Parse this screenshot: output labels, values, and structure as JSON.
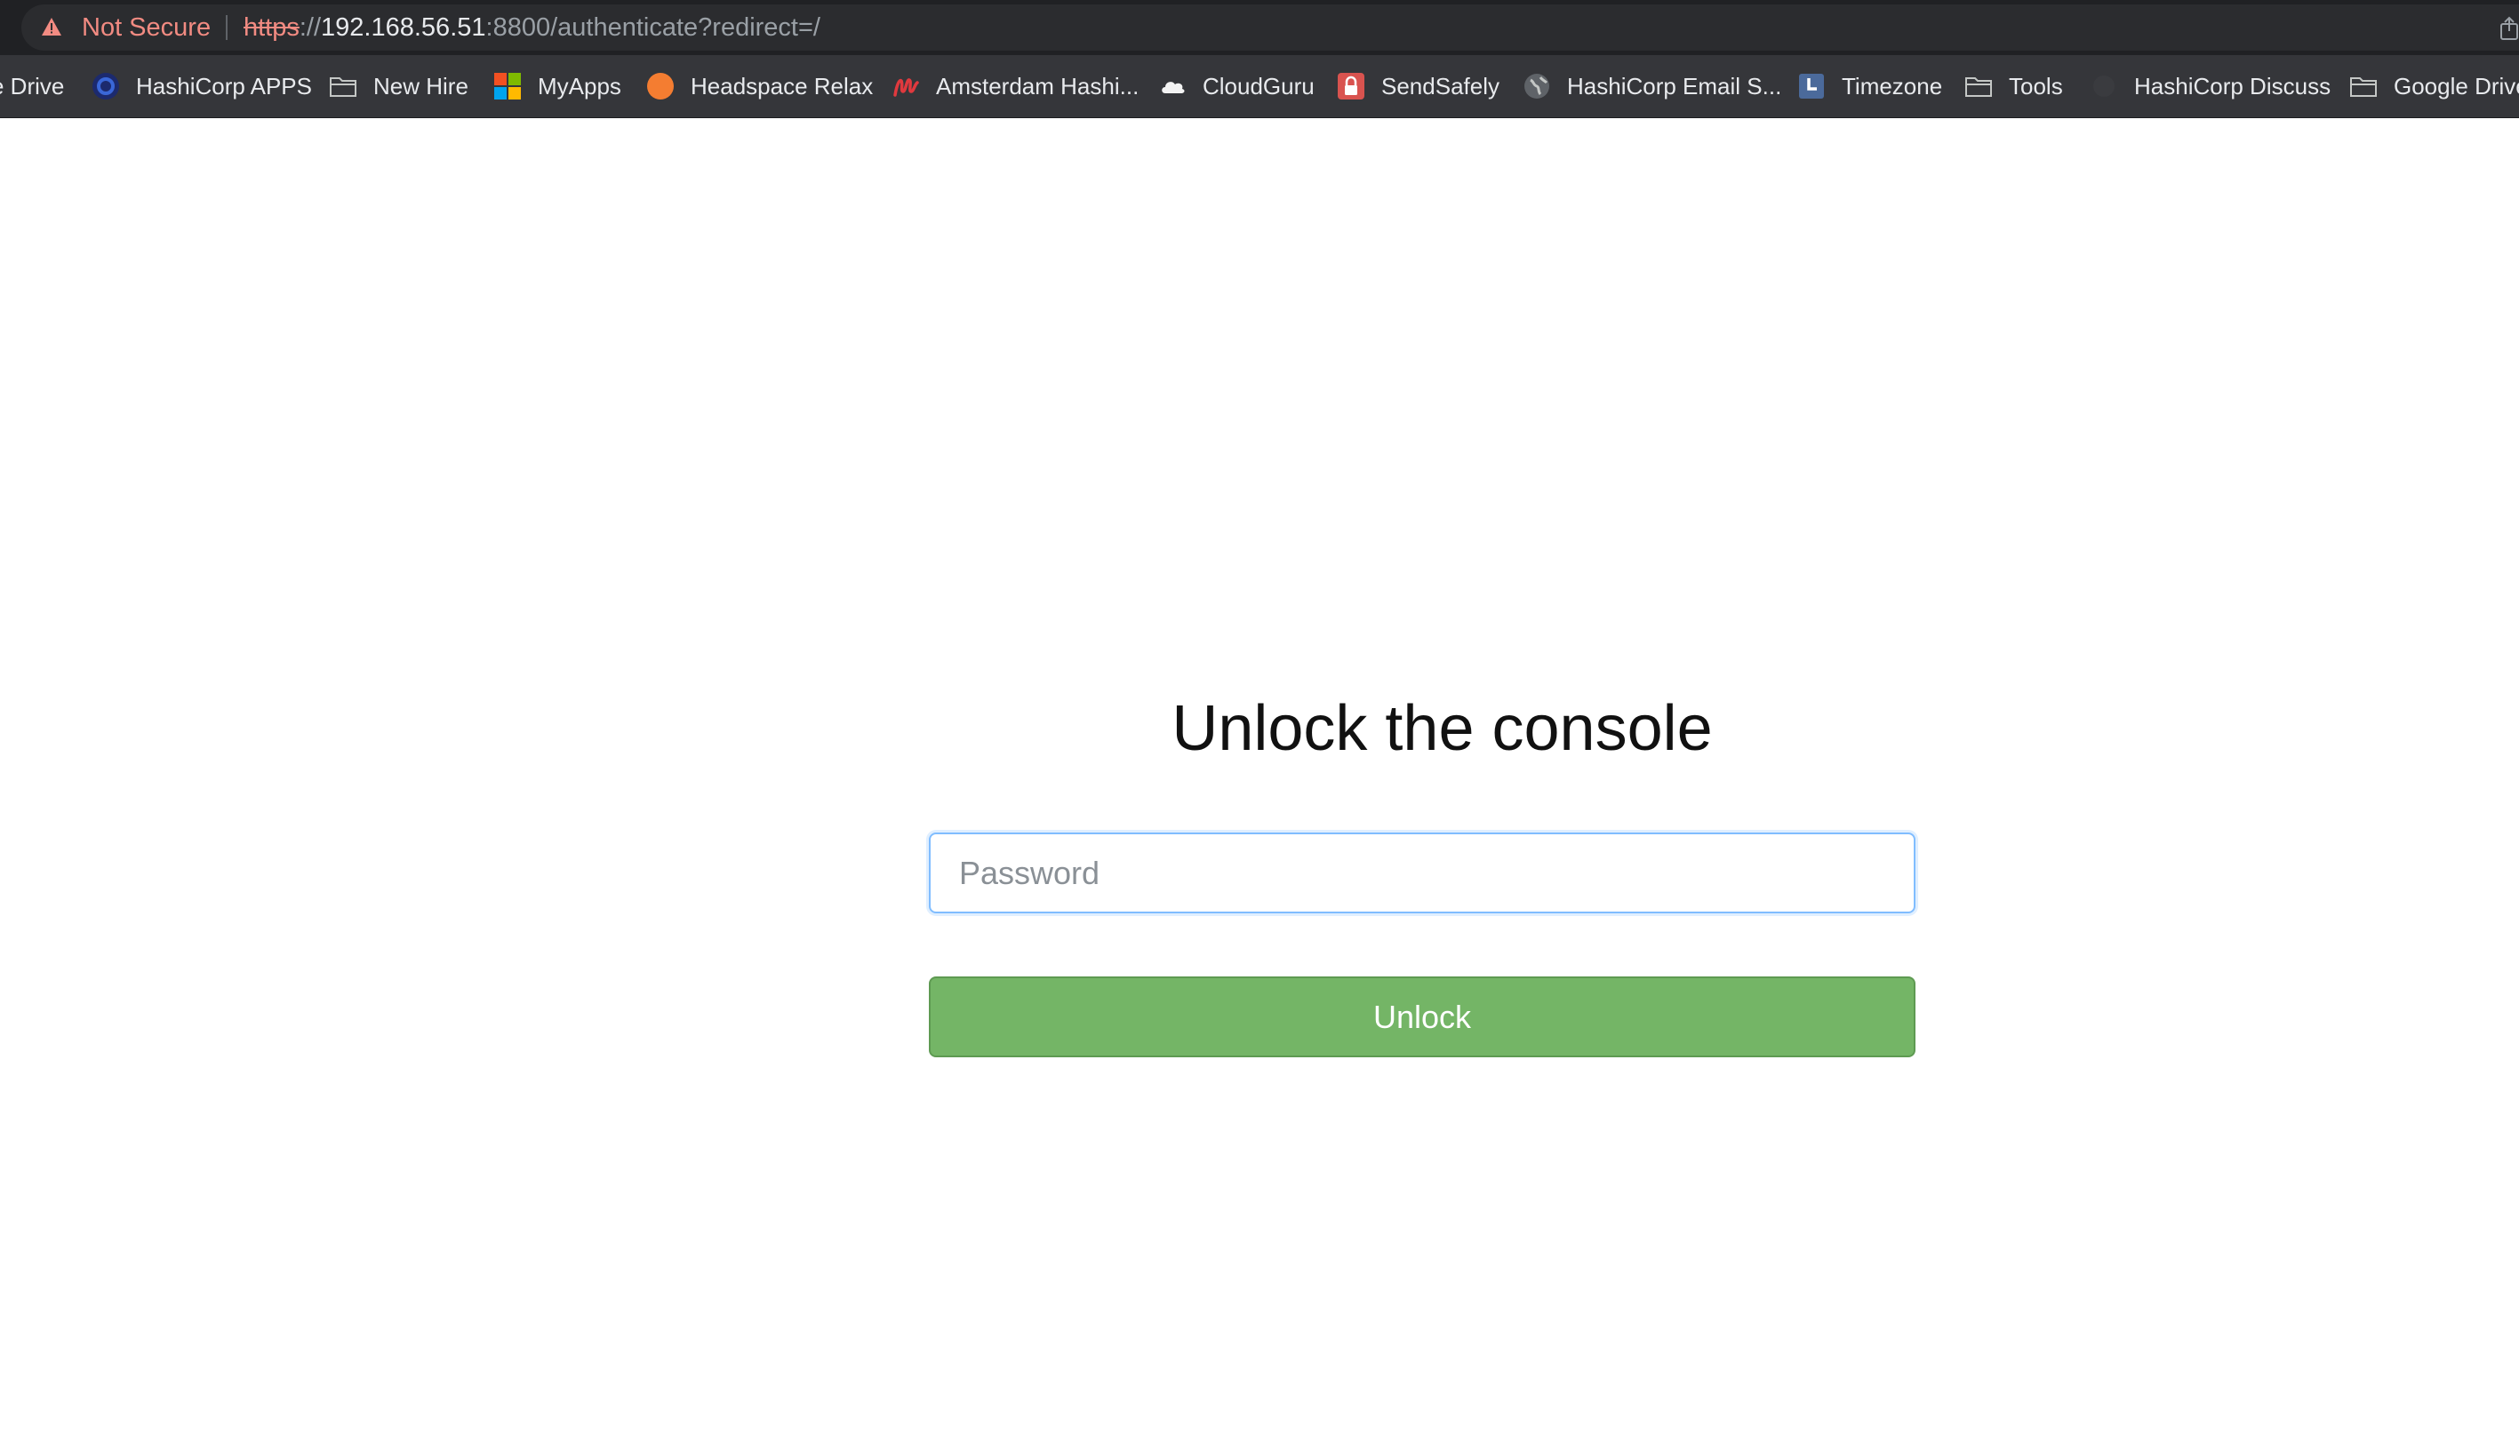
{
  "browser": {
    "security_label": "Not Secure",
    "url": {
      "scheme": "https",
      "separator": "://",
      "host": "192.168.56.51",
      "rest": ":8800/authenticate?redirect=/"
    },
    "bookmarks": [
      {
        "label": "e Drive",
        "icon": "drive-icon"
      },
      {
        "label": "HashiCorp APPS",
        "icon": "hashicorp-apps-icon"
      },
      {
        "label": "New Hire",
        "icon": "folder-icon"
      },
      {
        "label": "MyApps",
        "icon": "microsoft-apps-icon"
      },
      {
        "label": "Headspace Relax",
        "icon": "headspace-icon"
      },
      {
        "label": "Amsterdam Hashi...",
        "icon": "meetup-icon"
      },
      {
        "label": "CloudGuru",
        "icon": "cloud-icon"
      },
      {
        "label": "SendSafely",
        "icon": "lock-icon"
      },
      {
        "label": "HashiCorp Email S...",
        "icon": "globe-icon"
      },
      {
        "label": "Timezone",
        "icon": "clock-icon"
      },
      {
        "label": "Tools",
        "icon": "folder-icon"
      },
      {
        "label": "HashiCorp Discuss",
        "icon": "discuss-icon"
      },
      {
        "label": "Google Drive",
        "icon": "folder-icon"
      }
    ]
  },
  "main": {
    "title": "Unlock the console",
    "password_placeholder": "Password",
    "unlock_label": "Unlock"
  },
  "colors": {
    "unlock_button": "#74b566",
    "input_focus_border": "#80bdff",
    "not_secure": "#f28b82"
  }
}
